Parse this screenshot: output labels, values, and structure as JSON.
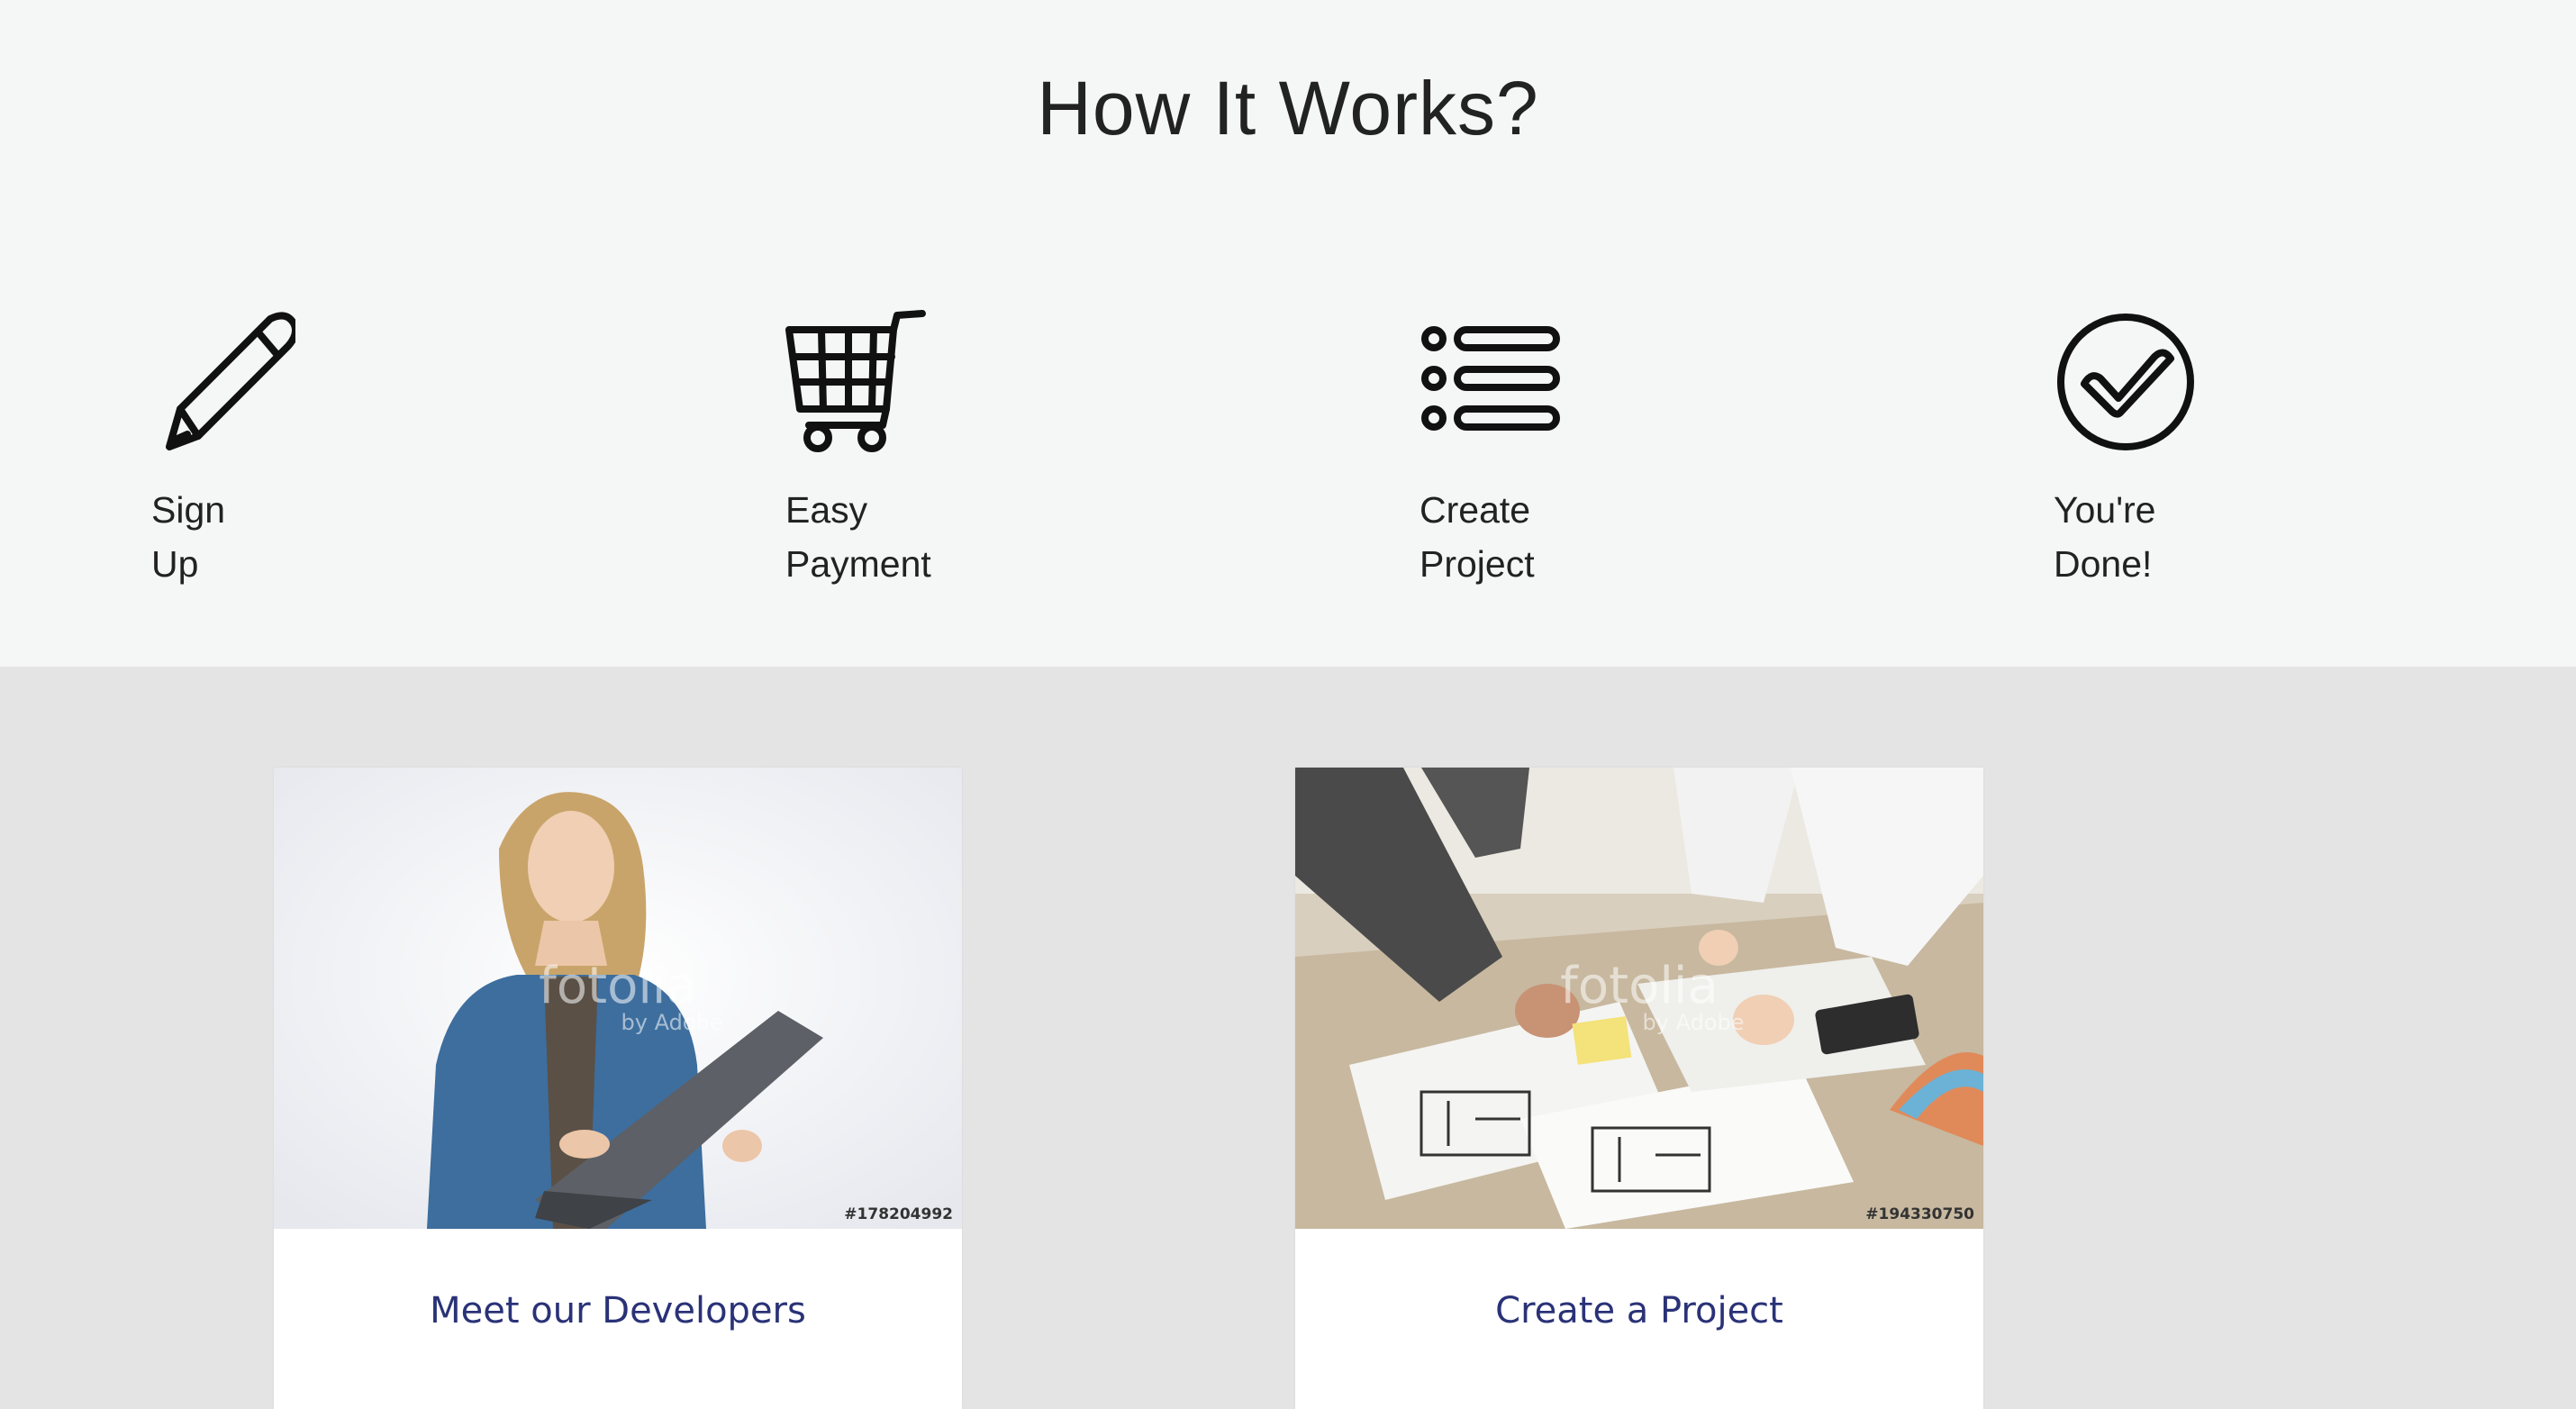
{
  "how_it_works": {
    "title": "How It Works?",
    "steps": [
      {
        "icon": "pencil-icon",
        "line1": "Sign",
        "line2": "Up"
      },
      {
        "icon": "shopping-cart-icon",
        "line1": "Easy",
        "line2": "Payment"
      },
      {
        "icon": "list-icon",
        "line1": "Create",
        "line2": "Project"
      },
      {
        "icon": "check-circle-icon",
        "line1": "You're",
        "line2": "Done!"
      }
    ]
  },
  "cards": [
    {
      "label": "Meet our Developers",
      "stock_id": "#178204992",
      "watermark": "fotolia",
      "watermark_sub": "by Adobe"
    },
    {
      "label": "Create a Project",
      "stock_id": "#194330750",
      "watermark": "fotolia",
      "watermark_sub": "by Adobe"
    }
  ],
  "colors": {
    "top_background": "#f5f6f6",
    "bottom_background": "#e4e4e4",
    "link": "#2a3277",
    "icon": "#111111"
  }
}
